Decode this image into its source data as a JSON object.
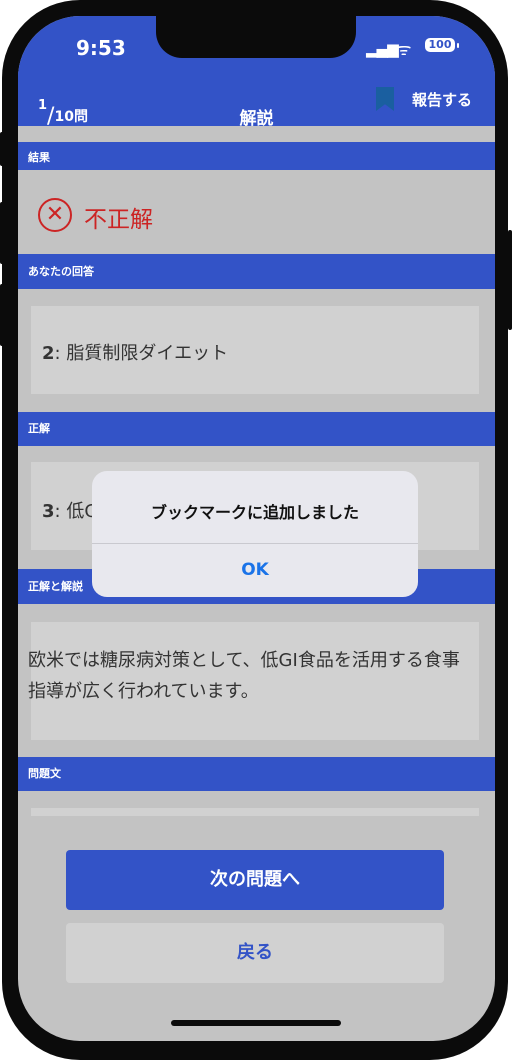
{
  "status_bar": {
    "time": "9:53",
    "battery": "100"
  },
  "nav": {
    "counter_current": "1",
    "counter_total": "10問",
    "title": "解説",
    "report_label": "報告する"
  },
  "sections": {
    "result": "結果",
    "your_answer": "あなたの回答",
    "correct": "正解",
    "explanation": "正解と解説",
    "question": "問題文"
  },
  "result": {
    "text": "不正解",
    "icon": "cross-circle-icon"
  },
  "your_answer": {
    "number": "2",
    "text": ": 脂質制限ダイエット"
  },
  "correct_answer": {
    "number": "3",
    "text": ": 低G"
  },
  "explanation_text": "欧米では糖尿病対策として、低GI食品を活用する食事指導が広く行われています。",
  "alert": {
    "title": "ブックマークに追加しました",
    "ok_label": "OK"
  },
  "buttons": {
    "next": "次の問題へ",
    "back": "戻る"
  },
  "colors": {
    "primary": "#3353c7",
    "error": "#cc2424",
    "link": "#1a73e8"
  }
}
